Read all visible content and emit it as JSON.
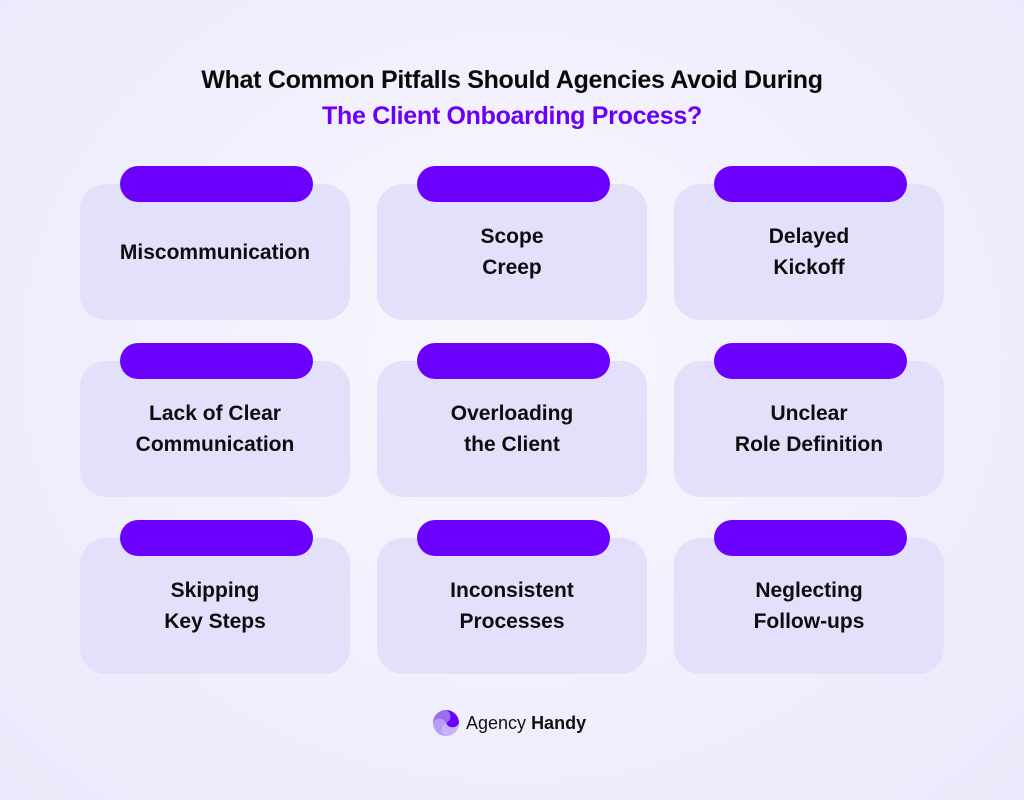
{
  "header": {
    "title_line1": "What Common Pitfalls Should Agencies Avoid During",
    "title_line2": "The Client Onboarding Process?"
  },
  "colors": {
    "accent": "#6c00ff",
    "card_bg": "#e3e0fb",
    "title_accent": "#6a00f4"
  },
  "pitfalls": [
    {
      "label": "Miscommunication"
    },
    {
      "label": "Scope\nCreep"
    },
    {
      "label": "Delayed\nKickoff"
    },
    {
      "label": "Lack of Clear\nCommunication"
    },
    {
      "label": "Overloading\nthe Client"
    },
    {
      "label": "Unclear\nRole Definition"
    },
    {
      "label": "Skipping\nKey Steps"
    },
    {
      "label": "Inconsistent\nProcesses"
    },
    {
      "label": "Neglecting\nFollow-ups"
    }
  ],
  "brand": {
    "icon": "agency-handy-logo-icon",
    "name_regular": "Agency",
    "name_bold": "Handy"
  }
}
